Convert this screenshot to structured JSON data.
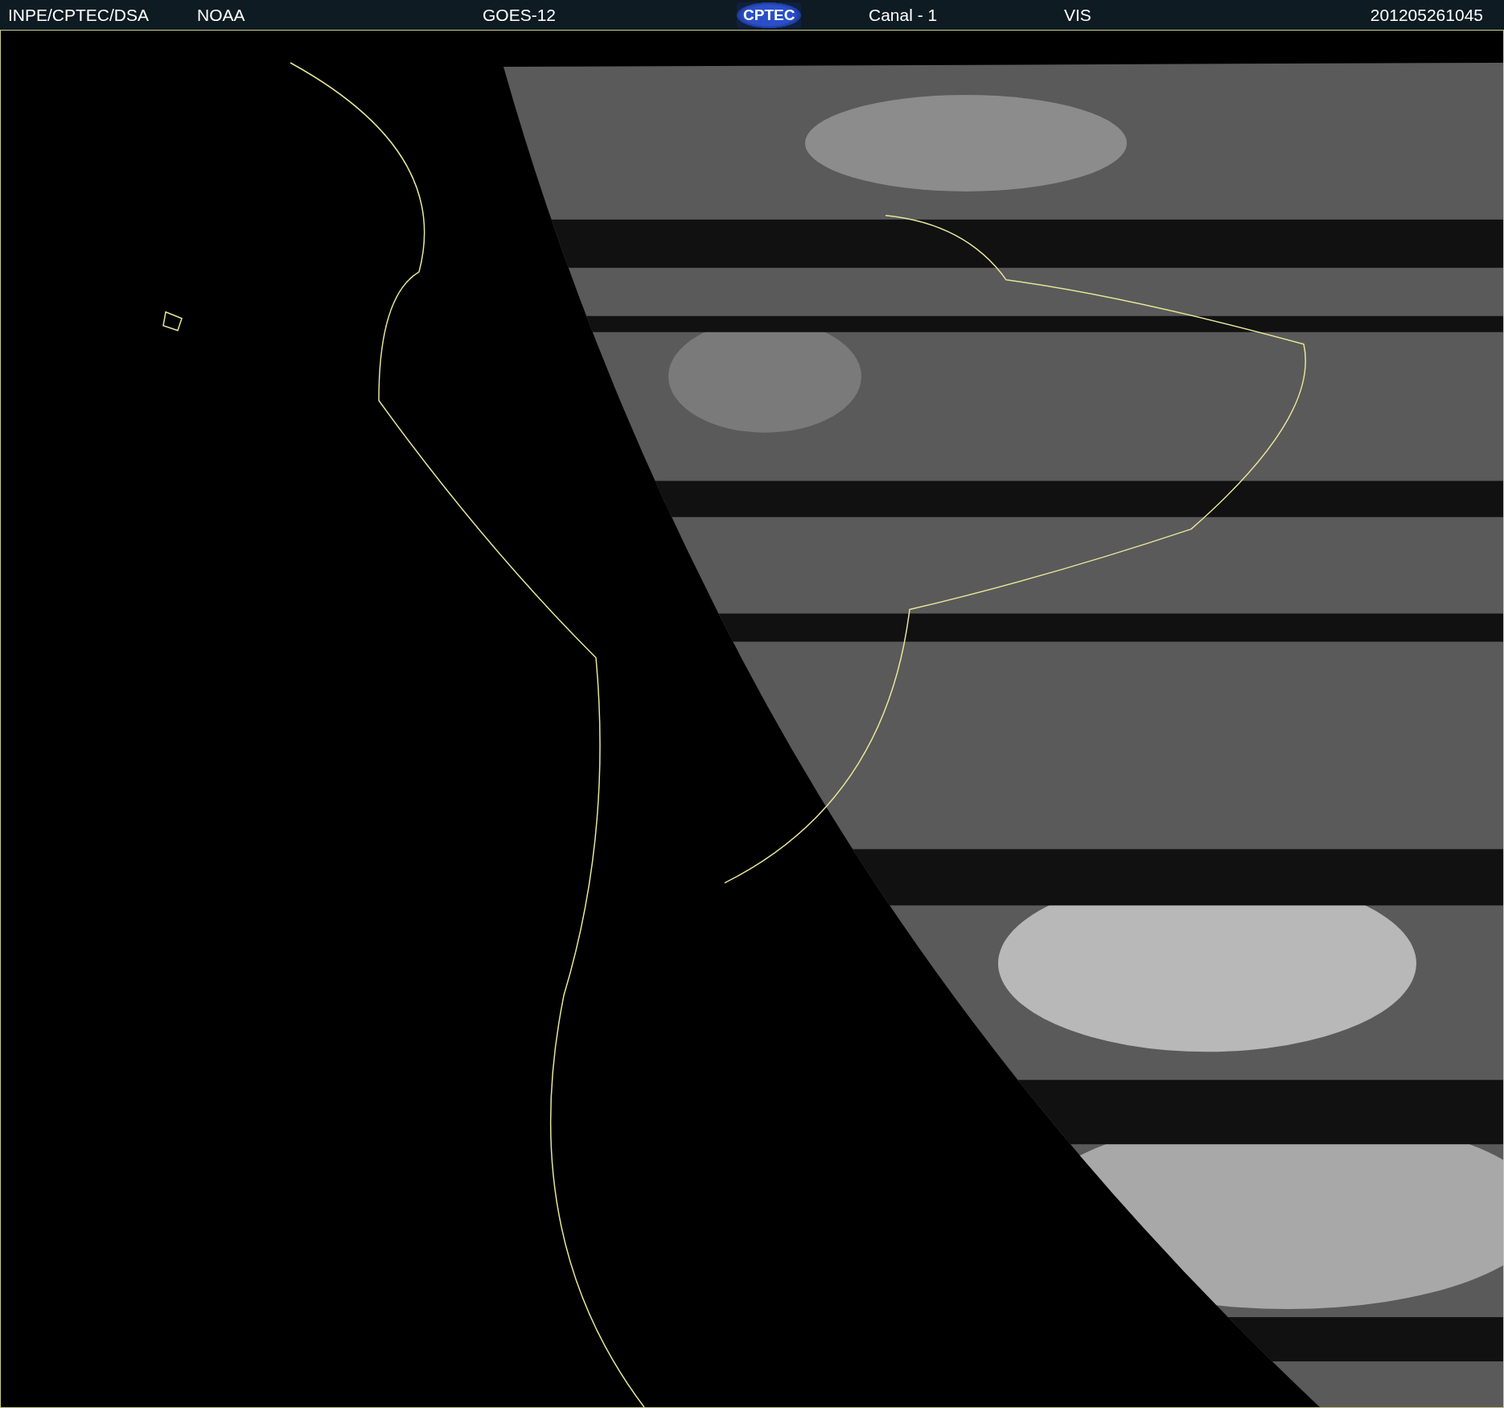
{
  "header": {
    "institute": "INPE/CPTEC/DSA",
    "agency": "NOAA",
    "satellite": "GOES-12",
    "logo": "CPTEC",
    "channel": "Canal - 1",
    "band": "VIS",
    "timestamp": "201205261045"
  }
}
